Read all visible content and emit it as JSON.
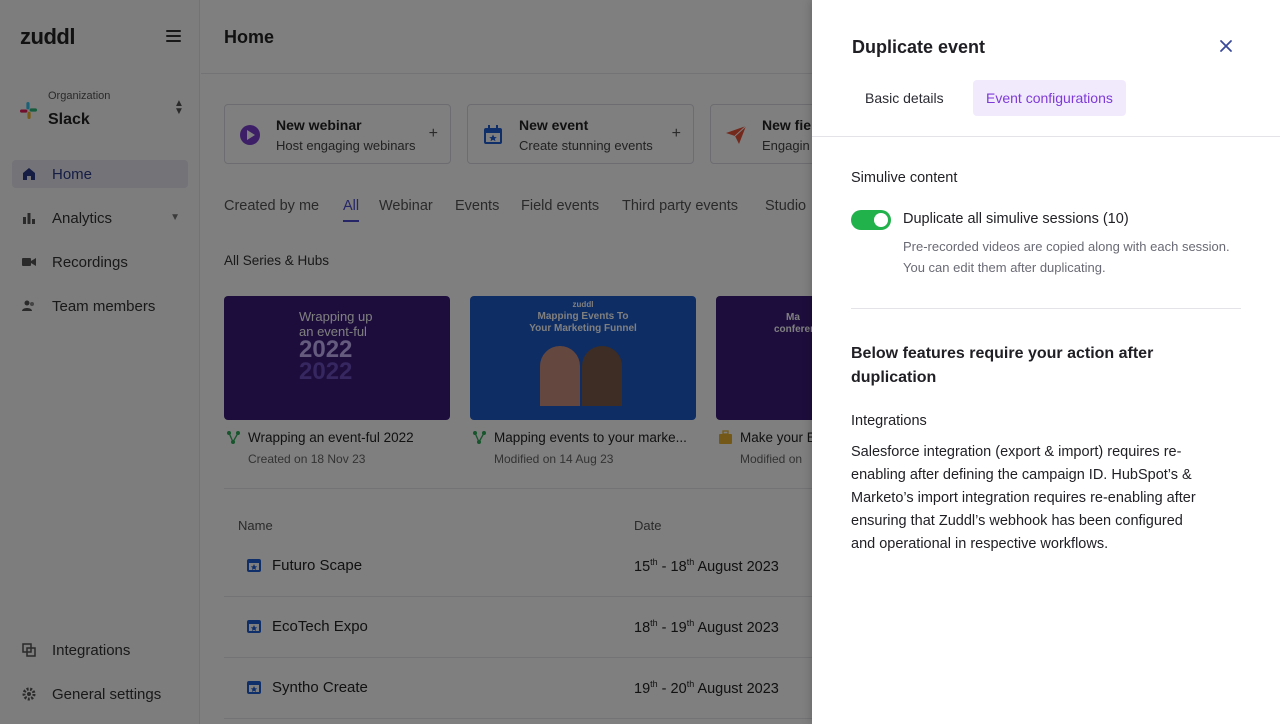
{
  "sidebar": {
    "logo": "zuddl",
    "org_caption": "Organization",
    "org_name": "Slack",
    "items": [
      {
        "label": "Home"
      },
      {
        "label": "Analytics"
      },
      {
        "label": "Recordings"
      },
      {
        "label": "Team members"
      }
    ],
    "bottom_items": [
      {
        "label": "Integrations"
      },
      {
        "label": "General settings"
      }
    ]
  },
  "header": {
    "title": "Home"
  },
  "quick_actions": [
    {
      "title": "New webinar",
      "subtitle": "Host engaging webinars"
    },
    {
      "title": "New event",
      "subtitle": "Create stunning events"
    },
    {
      "title": "New fie",
      "subtitle": "Engagin"
    }
  ],
  "filter_tabs": [
    "Created by me",
    "All",
    "Webinar",
    "Events",
    "Field events",
    "Third party events",
    "Studio"
  ],
  "section_label": "All Series & Hubs",
  "hubs": [
    {
      "title": "Wrapping an event-ful 2022",
      "date": "Created on 18 Nov 23",
      "thumb_line1": "Wrapping up",
      "thumb_line2": "an event-ful",
      "thumb_year": "2022"
    },
    {
      "title": "Mapping events to your marke...",
      "date": "Modified on 14 Aug 23",
      "thumb_brand": "zuddl",
      "thumb_line1": "Mapping Events To",
      "thumb_line2": "Your Marketing Funnel"
    },
    {
      "title": "Make your E",
      "date": "Modified on",
      "thumb_line1": "Ma",
      "thumb_line2": "conferen"
    }
  ],
  "table": {
    "col_name": "Name",
    "col_date": "Date",
    "rows": [
      {
        "name": "Futuro Scape",
        "d1": "15",
        "s1": "th",
        "d2": "18",
        "s2": "th",
        "rest": "August 2023"
      },
      {
        "name": "EcoTech Expo",
        "d1": "18",
        "s1": "th",
        "d2": "19",
        "s2": "th",
        "rest": "August 2023"
      },
      {
        "name": "Syntho Create",
        "d1": "19",
        "s1": "th",
        "d2": "20",
        "s2": "th",
        "rest": "August 2023"
      }
    ]
  },
  "drawer": {
    "title": "Duplicate event",
    "tabs": [
      "Basic details",
      "Event configurations"
    ],
    "active_tab": "Event configurations",
    "simulive_title": "Simulive content",
    "toggle_label": "Duplicate all simulive sessions (10)",
    "toggle_on": true,
    "toggle_help": "Pre-recorded videos are copied along with each session. You can edit them after duplicating.",
    "action_heading": "Below features require your action after duplication",
    "integrations_title": "Integrations",
    "integrations_body": "Salesforce integration (export & import) requires re-enabling after defining the campaign ID. HubSpot’s & Marketo’s import integration requires re-enabling after ensuring that Zuddl’s webhook has been configured and operational in respective workflows."
  },
  "colors": {
    "accent_purple": "#7e3ad8",
    "active_tab_bg": "#f1eafd",
    "toggle_green": "#22b24c",
    "link_blue": "#3a4a9a"
  }
}
